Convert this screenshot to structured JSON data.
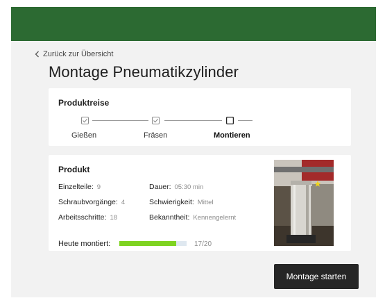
{
  "colors": {
    "topbar": "#2c6a32",
    "accent_progress": "#7ed321",
    "button": "#262626"
  },
  "nav": {
    "back_label": "Zurück zur Übersicht",
    "back_icon": "chevron-left-icon"
  },
  "page": {
    "title": "Montage Pneumatikzylinder"
  },
  "produktreise": {
    "heading": "Produktreise",
    "steps": [
      {
        "label": "Gießen",
        "status": "done",
        "icon": "checkbox-checked-icon"
      },
      {
        "label": "Fräsen",
        "status": "done",
        "icon": "checkbox-checked-icon"
      },
      {
        "label": "Montieren",
        "status": "current",
        "icon": "checkbox-empty-icon"
      }
    ]
  },
  "produkt": {
    "heading": "Produkt",
    "einzelteile": {
      "label": "Einzelteile:",
      "value": "9"
    },
    "schraubvorgaenge": {
      "label": "Schraubvorgänge:",
      "value": "4"
    },
    "arbeitsschritte": {
      "label": "Arbeitsschritte:",
      "value": "18"
    },
    "dauer": {
      "label": "Dauer:",
      "value": "05:30 min"
    },
    "schwierigkeit": {
      "label": "Schwierigkeit:",
      "value": "Mittel"
    },
    "bekanntheit": {
      "label": "Bekanntheit:",
      "value": "Kennengelernt"
    },
    "heute": {
      "label": "Heute montiert:",
      "count_text": "17/20",
      "done": 17,
      "total": 20
    }
  },
  "actions": {
    "start_label": "Montage starten"
  }
}
